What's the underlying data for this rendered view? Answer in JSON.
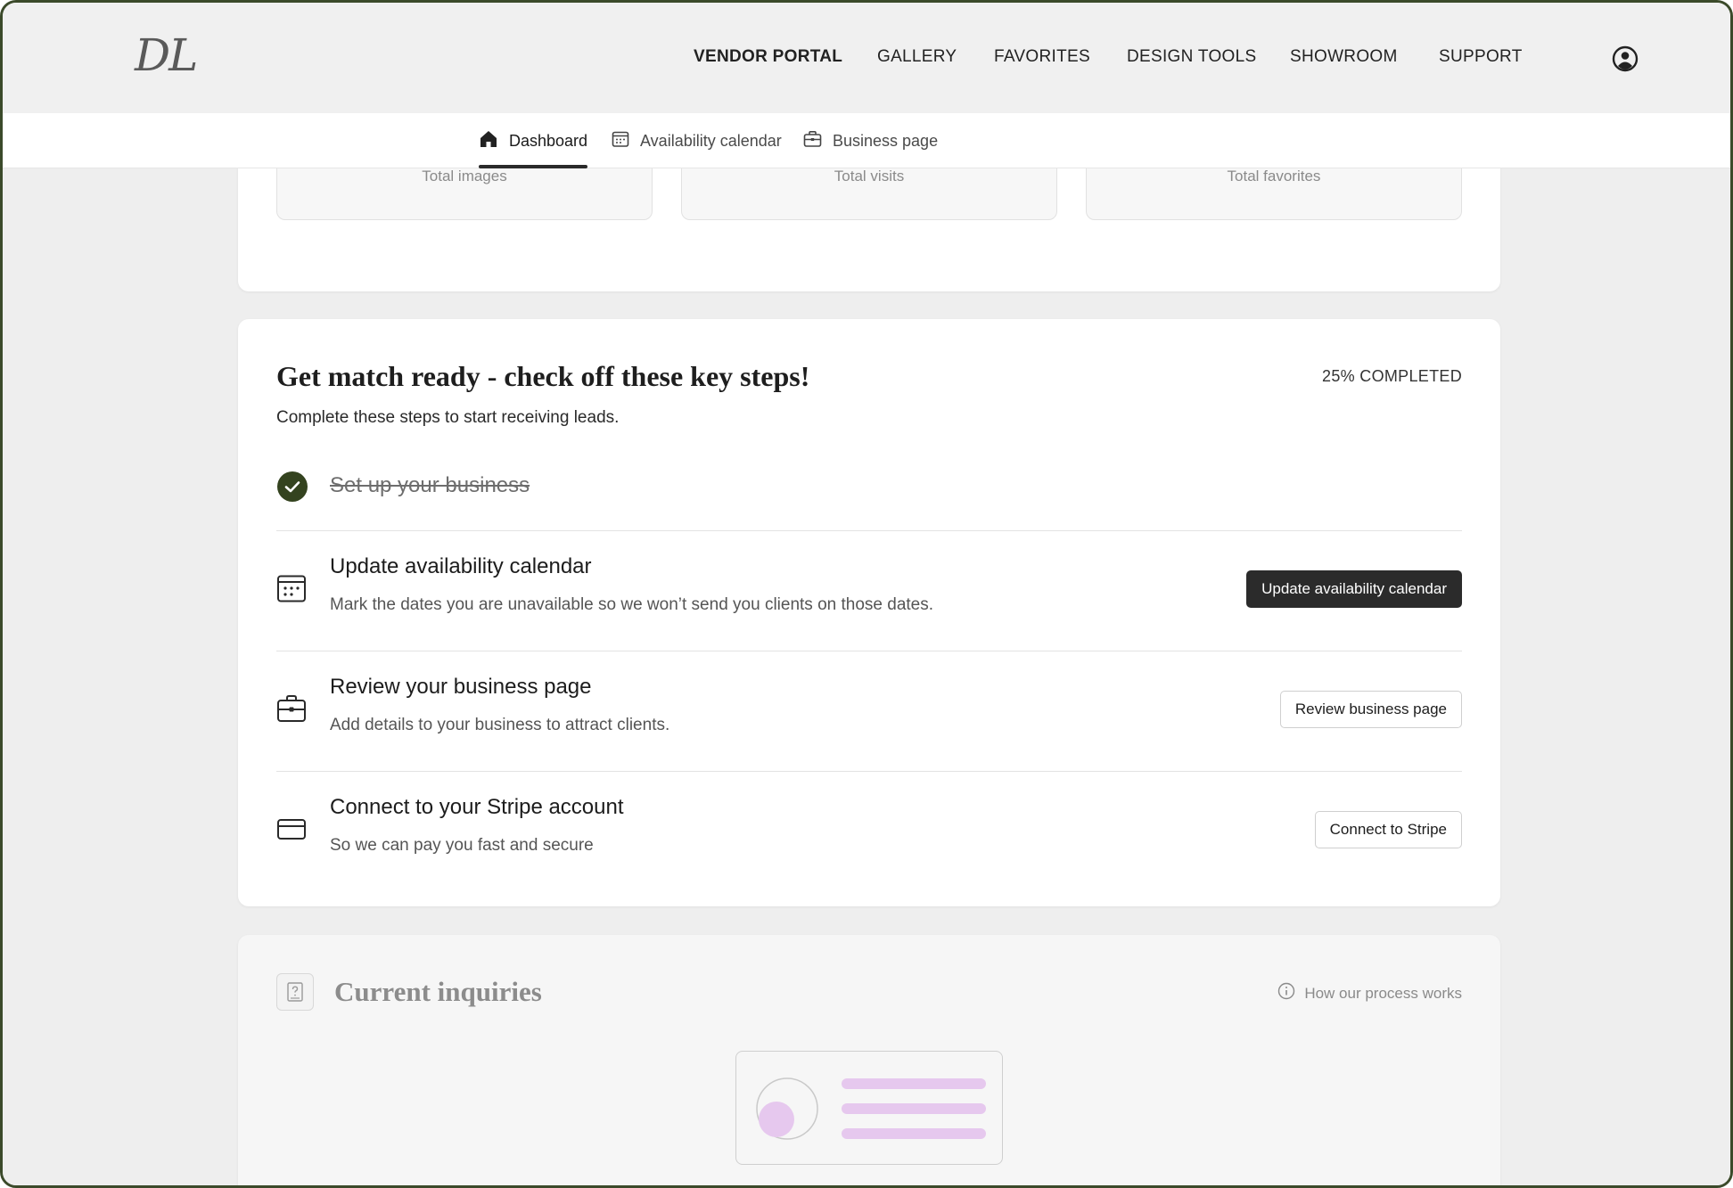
{
  "brand": {
    "logo_text": "DL"
  },
  "topnav": {
    "links": [
      {
        "label": "VENDOR PORTAL",
        "active": true
      },
      {
        "label": "GALLERY"
      },
      {
        "label": "FAVORITES"
      },
      {
        "label": "DESIGN TOOLS"
      },
      {
        "label": "SHOWROOM"
      },
      {
        "label": "SUPPORT"
      }
    ],
    "account_icon": "account-circle-icon"
  },
  "subnav": {
    "tabs": [
      {
        "label": "Dashboard",
        "icon": "home-icon",
        "active": true
      },
      {
        "label": "Availability calendar",
        "icon": "calendar-icon"
      },
      {
        "label": "Business page",
        "icon": "briefcase-icon"
      }
    ]
  },
  "stats": {
    "items": [
      {
        "label": "Total images"
      },
      {
        "label": "Total visits"
      },
      {
        "label": "Total favorites"
      }
    ]
  },
  "steps": {
    "title": "Get match ready - check off these key steps!",
    "progress_label": "25% COMPLETED",
    "progress_fraction": 0.25,
    "subtitle": "Complete these steps to start receiving leads.",
    "items": [
      {
        "title": "Set up your business",
        "done": true,
        "icon": "check-circle-icon"
      },
      {
        "title": "Update availability calendar",
        "description": "Mark the dates you are unavailable so we won’t send you clients on those dates.",
        "button": "Update availability calendar",
        "icon": "calendar-icon"
      },
      {
        "title": "Review your business page",
        "description": "Add details to your business to attract clients.",
        "button": "Review business page",
        "icon": "briefcase-icon"
      },
      {
        "title": "Connect to your Stripe account",
        "description": "So we can pay you fast and secure",
        "button": "Connect to Stripe",
        "icon": "credit-card-icon"
      }
    ]
  },
  "inquiries": {
    "title": "Current inquiries",
    "help_label": "How our process works",
    "icon": "question-document-icon",
    "illustration": "empty-state-illustration"
  },
  "colors": {
    "check_green": "#34431f",
    "dark_button": "#2b2b2b",
    "illustration_pink": "#e6c8ee",
    "frame_border": "#3b4a2a"
  }
}
